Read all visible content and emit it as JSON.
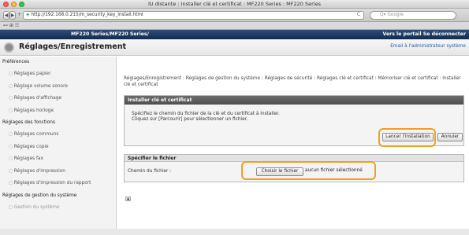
{
  "window": {
    "title": "IU distante : Installer clé et certificat : MF220 Series : MF220 Series"
  },
  "browser": {
    "back_icon": "◀",
    "forward_icon": "▶",
    "add_icon": "+",
    "url": "http://192.168.0.215/m_security_key_install.html",
    "reload_icon": "C",
    "search_placeholder": "Q▾ Google",
    "bookmarks": "⊷  ⊞  ☷"
  },
  "header": {
    "model": "MF220 Series/MF220 Series/",
    "links": "Vers le portail  Se déconnecter"
  },
  "subheader": {
    "title": "Réglages/Enregistrement",
    "mail_link": "Email à l'administrateur système"
  },
  "sidebar": {
    "sections": [
      {
        "label": "Préférences",
        "items": [
          "Réglages papier",
          "Réglage volume sonore",
          "Réglages d'affichage",
          "Réglages horloge"
        ]
      },
      {
        "label": "Réglages des fonctions",
        "items": [
          "Réglages communs",
          "Réglages copie",
          "Réglages fax",
          "Réglages d'impression",
          "Réglages d'impression du rapport"
        ]
      },
      {
        "label": "Réglages de gestion du système",
        "items": [
          "Gestion du système"
        ]
      }
    ]
  },
  "breadcrumb": "Réglages/Enregistrement : Réglages de gestion du système : Réglages de sécurité : Réglages clé et certificat : Mémoriser clé et certificat : Installer clé et certificat",
  "install_section": {
    "title": "Installer clé et certificat",
    "desc1": "Spécifiez le chemin du fichier de la clé et du certificat à installer.",
    "desc2": "Cliquez sur [Parcourir] pour sélectionner un fichier.",
    "start_button": "Lancer l'installation",
    "cancel_button": "Annuler"
  },
  "file_section": {
    "title": "Spécifier le fichier",
    "path_label": "Chemin du fichier :",
    "choose_button": "Choisir le fichier",
    "no_file_text": "aucun fichier sélectionné"
  },
  "top_icon": "▲",
  "colors": {
    "highlight": "#f0a020",
    "header": "#1e3a63",
    "link": "#2a5a9a"
  }
}
